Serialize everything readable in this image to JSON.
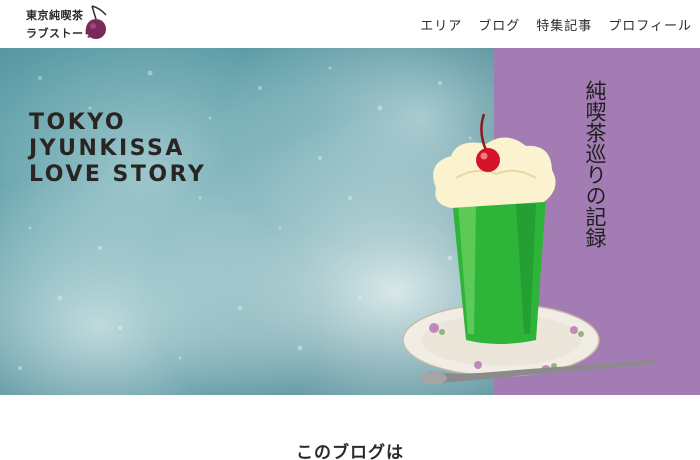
{
  "logo": {
    "line1": "東京純喫茶",
    "line2": "ラブストーリー"
  },
  "nav": {
    "items": [
      {
        "label": "エリア"
      },
      {
        "label": "ブログ"
      },
      {
        "label": "特集記事"
      },
      {
        "label": "プロフィール"
      }
    ]
  },
  "hero": {
    "title_lines": [
      "TOKYO",
      "JYUNKISSA",
      "LOVE STORY"
    ],
    "vertical_caption": "純喫茶巡りの記録"
  },
  "section": {
    "heading": "このブログは"
  },
  "colors": {
    "purple_panel": "#a37cb4",
    "cream_soda_green": "#2fb43a",
    "cherry_red": "#d4142a",
    "water_blue": "#5f9ea8"
  },
  "icons": [
    "cherry-icon"
  ]
}
